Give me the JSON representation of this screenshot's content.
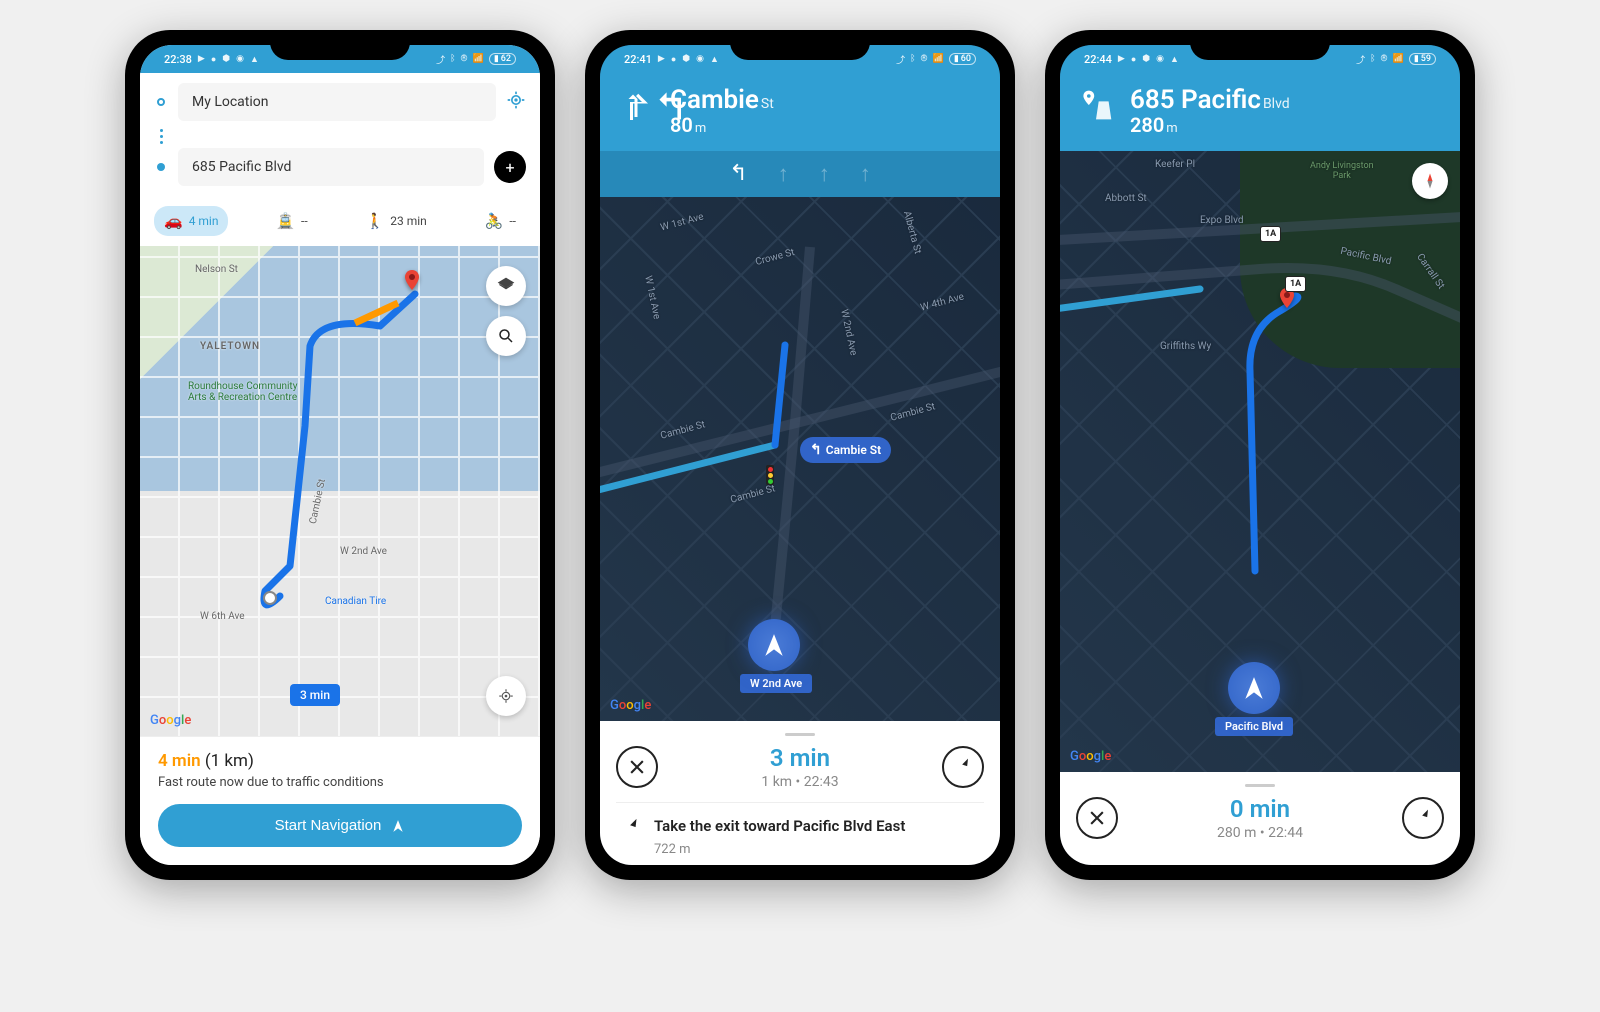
{
  "phone1": {
    "statusbar": {
      "time": "22:38",
      "battery": "62"
    },
    "inputs": {
      "from": "My Location",
      "to": "685 Pacific Blvd"
    },
    "modes": {
      "car": "4 min",
      "transit": "--",
      "walk": "23 min",
      "bike": "--"
    },
    "map": {
      "yaletown": "YALETOWN",
      "poi1": "Roundhouse Community\nArts & Recreation Centre",
      "poi2": "Canadian Tire",
      "street1": "Nelson St",
      "street2": "W 2nd Ave",
      "street3": "W 6th Ave",
      "street4": "Cambie St",
      "time_pill": "3 min"
    },
    "bottom": {
      "eta_time": "4 min",
      "eta_dist": "(1 km)",
      "sub": "Fast route now due to traffic conditions",
      "start": "Start Navigation"
    },
    "google": "Google"
  },
  "phone2": {
    "statusbar": {
      "time": "22:41",
      "battery": "60"
    },
    "header": {
      "street": "Cambie",
      "suffix": "St",
      "dist": "80",
      "unit": "m"
    },
    "map": {
      "s1": "W 1st Ave",
      "s2": "Crowe St",
      "s3": "Alberta St",
      "s4": "W 1st Ave",
      "s5": "W 2nd Ave",
      "s6": "W 4th Ave",
      "s7": "Cambie St",
      "s8": "Cambie St",
      "s9": "Cambie St",
      "callout": "Cambie St",
      "road_pill": "W 2nd Ave"
    },
    "bottom": {
      "eta": "3 min",
      "detail": "1 km • 22:43",
      "step_text": "Take the exit toward Pacific Blvd East",
      "step_dist": "722 m"
    },
    "google": "Google"
  },
  "phone3": {
    "statusbar": {
      "time": "22:44",
      "battery": "59"
    },
    "header": {
      "street": "685 Pacific",
      "suffix": "Blvd",
      "dist": "280",
      "unit": "m"
    },
    "map": {
      "s1": "Keefer Pl",
      "s2": "Abbott St",
      "s3": "Expo Blvd",
      "s4": "Pacific Blvd",
      "s5": "Griffiths Wy",
      "s6": "Carrall St",
      "park": "Andy Livingston\nPark",
      "hwy": "1A",
      "road_pill": "Pacific Blvd"
    },
    "bottom": {
      "eta": "0 min",
      "detail": "280 m • 22:44"
    },
    "google": "Google"
  }
}
